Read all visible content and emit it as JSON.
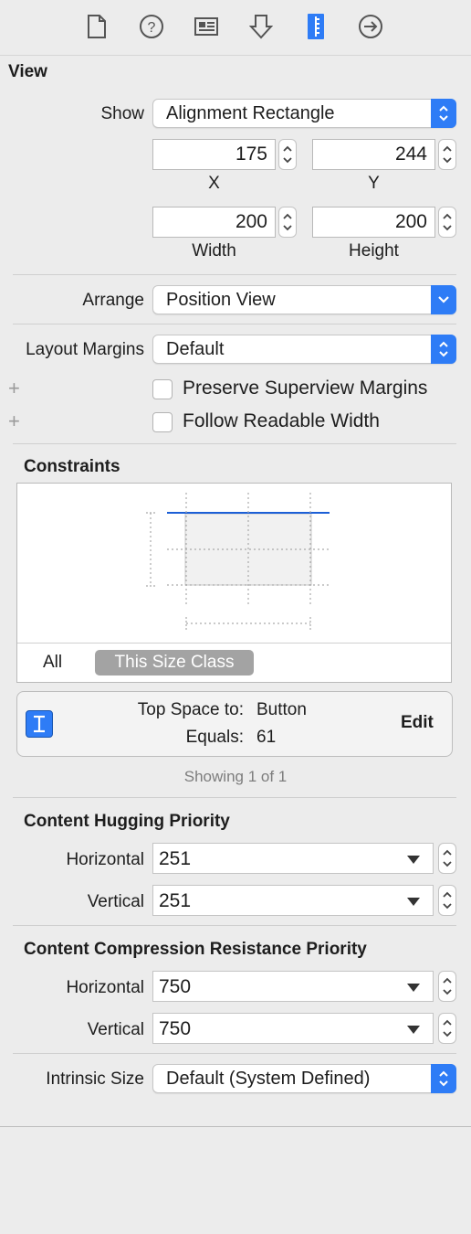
{
  "colors": {
    "accent": "#2e7cf6",
    "panel_bg": "#ececec",
    "constraint_line": "#1c5fd6"
  },
  "toolbar": {
    "icons": [
      "file-inspector-icon",
      "quick-help-icon",
      "identity-inspector-icon",
      "attributes-inspector-icon",
      "size-inspector-icon",
      "connections-inspector-icon"
    ],
    "selected": "size-inspector-icon"
  },
  "view_section": {
    "title": "View",
    "show_label": "Show",
    "show_value": "Alignment Rectangle",
    "x_value": "175",
    "y_value": "244",
    "x_label": "X",
    "y_label": "Y",
    "width_value": "200",
    "height_value": "200",
    "width_label": "Width",
    "height_label": "Height",
    "arrange_label": "Arrange",
    "arrange_value": "Position View",
    "layout_margins_label": "Layout Margins",
    "layout_margins_value": "Default",
    "preserve_label": "Preserve Superview Margins",
    "preserve_checked": false,
    "readable_label": "Follow Readable Width",
    "readable_checked": false
  },
  "constraints": {
    "title": "Constraints",
    "tab_all": "All",
    "tab_size_class": "This Size Class",
    "active_tab": "This Size Class",
    "item_label": "Top Space to:",
    "item_target": "Button",
    "equals_label": "Equals:",
    "equals_value": "61",
    "edit_label": "Edit",
    "showing": "Showing 1 of 1"
  },
  "hugging": {
    "title": "Content Hugging Priority",
    "horizontal_label": "Horizontal",
    "horizontal_value": "251",
    "vertical_label": "Vertical",
    "vertical_value": "251"
  },
  "compression": {
    "title": "Content Compression Resistance Priority",
    "horizontal_label": "Horizontal",
    "horizontal_value": "750",
    "vertical_label": "Vertical",
    "vertical_value": "750"
  },
  "intrinsic": {
    "label": "Intrinsic Size",
    "value": "Default (System Defined)"
  }
}
